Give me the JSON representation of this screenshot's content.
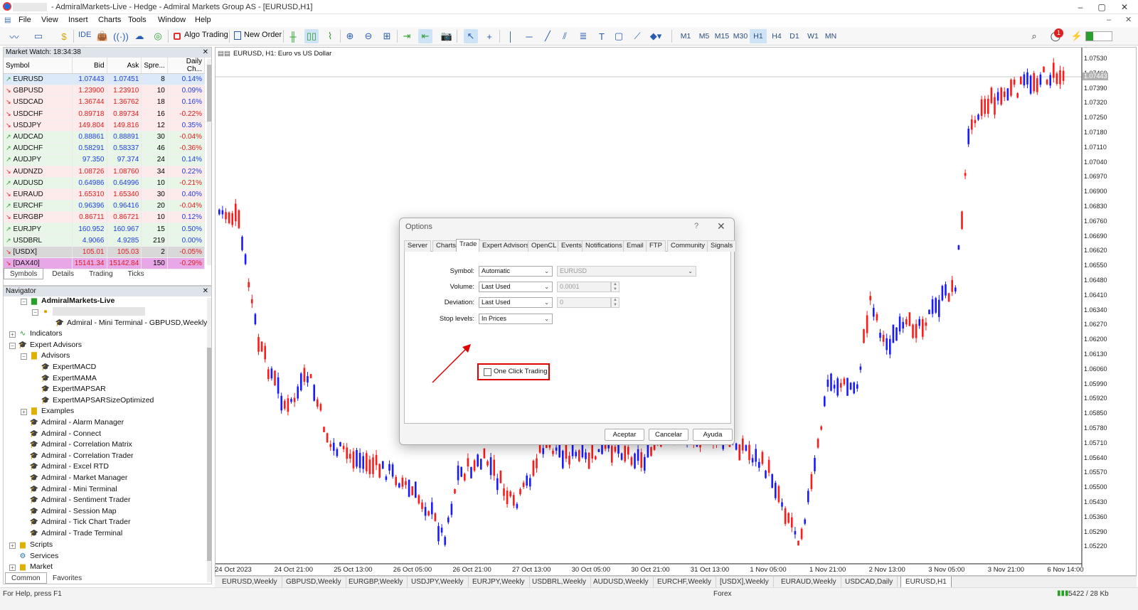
{
  "window": {
    "title": "- AdmiralMarkets-Live - Hedge - Admiral Markets Group AS - [EURUSD,H1]",
    "controls": [
      "–",
      "▢",
      "✕"
    ]
  },
  "menu": [
    "File",
    "View",
    "Insert",
    "Charts",
    "Tools",
    "Window",
    "Help"
  ],
  "toolbar": {
    "ide": "IDE",
    "algo_trading": "Algo Trading",
    "new_order": "New Order",
    "timeframes": [
      "M1",
      "M5",
      "M15",
      "M30",
      "H1",
      "H4",
      "D1",
      "W1",
      "MN"
    ],
    "active_timeframe": "H1",
    "notification_count": "1"
  },
  "market_watch": {
    "title": "Market Watch: 18:34:38",
    "columns": [
      "Symbol",
      "Bid",
      "Ask",
      "Spre...",
      "Daily Ch..."
    ],
    "rows": [
      {
        "symbol": "EURUSD",
        "bid": "1.07443",
        "ask": "1.07451",
        "spread": "8",
        "change": "0.14%",
        "dir": "up"
      },
      {
        "symbol": "GBPUSD",
        "bid": "1.23900",
        "ask": "1.23910",
        "spread": "10",
        "change": "0.09%",
        "dir": "down"
      },
      {
        "symbol": "USDCAD",
        "bid": "1.36744",
        "ask": "1.36762",
        "spread": "18",
        "change": "0.16%",
        "dir": "down"
      },
      {
        "symbol": "USDCHF",
        "bid": "0.89718",
        "ask": "0.89734",
        "spread": "16",
        "change": "-0.22%",
        "dir": "down"
      },
      {
        "symbol": "USDJPY",
        "bid": "149.804",
        "ask": "149.816",
        "spread": "12",
        "change": "0.35%",
        "dir": "down"
      },
      {
        "symbol": "AUDCAD",
        "bid": "0.88861",
        "ask": "0.88891",
        "spread": "30",
        "change": "-0.04%",
        "dir": "up"
      },
      {
        "symbol": "AUDCHF",
        "bid": "0.58291",
        "ask": "0.58337",
        "spread": "46",
        "change": "-0.36%",
        "dir": "up"
      },
      {
        "symbol": "AUDJPY",
        "bid": "97.350",
        "ask": "97.374",
        "spread": "24",
        "change": "0.14%",
        "dir": "up"
      },
      {
        "symbol": "AUDNZD",
        "bid": "1.08726",
        "ask": "1.08760",
        "spread": "34",
        "change": "0.22%",
        "dir": "down"
      },
      {
        "symbol": "AUDUSD",
        "bid": "0.64986",
        "ask": "0.64996",
        "spread": "10",
        "change": "-0.21%",
        "dir": "up"
      },
      {
        "symbol": "EURAUD",
        "bid": "1.65310",
        "ask": "1.65340",
        "spread": "30",
        "change": "0.40%",
        "dir": "down"
      },
      {
        "symbol": "EURCHF",
        "bid": "0.96396",
        "ask": "0.96416",
        "spread": "20",
        "change": "-0.04%",
        "dir": "up"
      },
      {
        "symbol": "EURGBP",
        "bid": "0.86711",
        "ask": "0.86721",
        "spread": "10",
        "change": "0.12%",
        "dir": "down"
      },
      {
        "symbol": "EURJPY",
        "bid": "160.952",
        "ask": "160.967",
        "spread": "15",
        "change": "0.50%",
        "dir": "up"
      },
      {
        "symbol": "USDBRL",
        "bid": "4.9066",
        "ask": "4.9285",
        "spread": "219",
        "change": "0.00%",
        "dir": "up"
      },
      {
        "symbol": "[USDX]",
        "bid": "105.01",
        "ask": "105.03",
        "spread": "2",
        "change": "-0.05%",
        "dir": "down"
      },
      {
        "symbol": "[DAX40]",
        "bid": "15141.34",
        "ask": "15142.84",
        "spread": "150",
        "change": "-0.29%",
        "dir": "down"
      }
    ],
    "tabs": [
      "Symbols",
      "Details",
      "Trading",
      "Ticks"
    ],
    "active_tab": "Symbols"
  },
  "navigator": {
    "title": "Navigator",
    "account": "AdmiralMarkets-Live",
    "account_item": "Admiral - Mini Terminal - GBPUSD,Weekly",
    "indicators": "Indicators",
    "expert_advisors": "Expert Advisors",
    "advisors": "Advisors",
    "advisor_items": [
      "ExpertMACD",
      "ExpertMAMA",
      "ExpertMAPSAR",
      "ExpertMAPSARSizeOptimized"
    ],
    "examples": "Examples",
    "admiral_items": [
      "Admiral - Alarm Manager",
      "Admiral - Connect",
      "Admiral - Correlation Matrix",
      "Admiral - Correlation Trader",
      "Admiral - Excel RTD",
      "Admiral - Market Manager",
      "Admiral - Mini Terminal",
      "Admiral - Sentiment Trader",
      "Admiral - Session Map",
      "Admiral - Tick Chart Trader",
      "Admiral - Trade Terminal"
    ],
    "scripts": "Scripts",
    "services": "Services",
    "market": "Market",
    "tabs": [
      "Common",
      "Favorites"
    ],
    "active_tab": "Common"
  },
  "chart": {
    "label": "EURUSD, H1:  Euro vs US Dollar",
    "current_price": "1.07443",
    "price_ticks": [
      "1.07530",
      "1.07460",
      "1.07390",
      "1.07320",
      "1.07250",
      "1.07180",
      "1.07110",
      "1.07040",
      "1.06970",
      "1.06900",
      "1.06830",
      "1.06760",
      "1.06690",
      "1.06620",
      "1.06550",
      "1.06480",
      "1.06410",
      "1.06340",
      "1.06270",
      "1.06200",
      "1.06130",
      "1.06060",
      "1.05990",
      "1.05920",
      "1.05850",
      "1.05780",
      "1.05710",
      "1.05640",
      "1.05570",
      "1.05500",
      "1.05430",
      "1.05360",
      "1.05290",
      "1.05220"
    ],
    "time_ticks": [
      "24 Oct 2023",
      "24 Oct 21:00",
      "25 Oct 13:00",
      "26 Oct 05:00",
      "26 Oct 21:00",
      "27 Oct 13:00",
      "30 Oct 05:00",
      "30 Oct 21:00",
      "31 Oct 13:00",
      "1 Nov 05:00",
      "1 Nov 21:00",
      "2 Nov 13:00",
      "3 Nov 05:00",
      "3 Nov 21:00",
      "6 Nov 14:00"
    ],
    "up_color": "#1a1aff",
    "down_color": "#ff1a1a"
  },
  "chart_tabs": [
    "EURUSD,Weekly",
    "GBPUSD,Weekly",
    "EURGBP,Weekly",
    "USDJPY,Weekly",
    "EURJPY,Weekly",
    "USDBRL,Weekly",
    "AUDUSD,Weekly",
    "EURCHF,Weekly",
    "[USDX],Weekly",
    "EURAUD,Weekly",
    "USDCAD,Daily",
    "EURUSD,H1"
  ],
  "active_chart_tab": "EURUSD,H1",
  "status": {
    "help": "For Help, press F1",
    "profile": "Forex",
    "traffic": "5422 / 28 Kb"
  },
  "dialog": {
    "title": "Options",
    "help": "?",
    "close": "✕",
    "tabs": [
      "Server",
      "Charts",
      "Trade",
      "Expert Advisors",
      "OpenCL",
      "Events",
      "Notifications",
      "Email",
      "FTP",
      "Community",
      "Signals"
    ],
    "active_tab": "Trade",
    "fields": {
      "symbol_label": "Symbol:",
      "symbol_value": "Automatic",
      "symbol_extra": "EURUSD",
      "volume_label": "Volume:",
      "volume_value": "Last Used",
      "volume_extra": "0.0001",
      "deviation_label": "Deviation:",
      "deviation_value": "Last Used",
      "deviation_extra": "0",
      "stop_label": "Stop levels:",
      "stop_value": "In Prices"
    },
    "one_click_trading": "One Click Trading",
    "one_click_checked": false,
    "buttons": {
      "ok": "Aceptar",
      "cancel": "Cancelar",
      "help": "Ayuda"
    }
  }
}
